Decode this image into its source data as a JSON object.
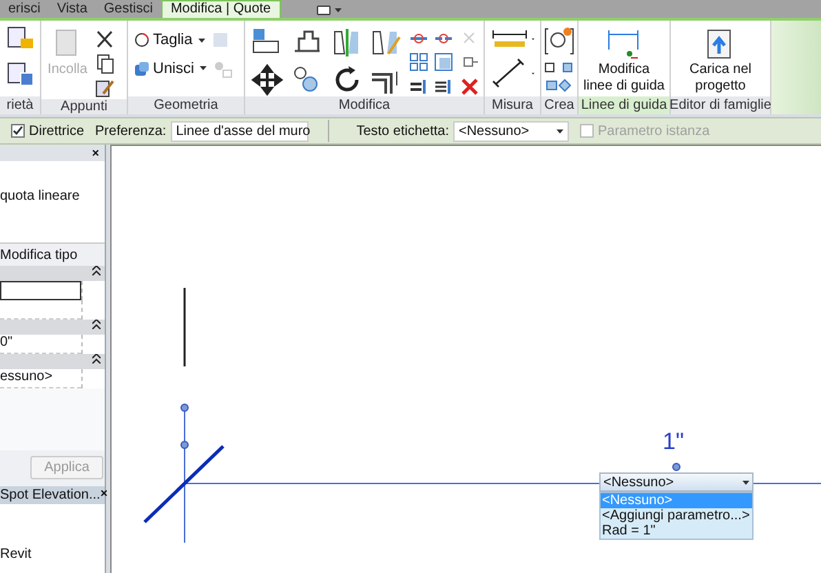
{
  "ribbon_tabs": [
    {
      "label": "erisci",
      "selected": false
    },
    {
      "label": "Vista",
      "selected": false
    },
    {
      "label": "Gestisci",
      "selected": false
    },
    {
      "label": "Modifica | Quote",
      "selected": true
    }
  ],
  "properties_panel_title": "rietà",
  "clipboard": {
    "title": "Appunti",
    "paste": {
      "label": "Incolla",
      "disabled": true
    }
  },
  "geometry": {
    "title": "Geometria",
    "cut": "Taglia",
    "join": "Unisci"
  },
  "modify": {
    "title": "Modifica"
  },
  "measure": {
    "title": "Misura"
  },
  "create": {
    "title": "Crea"
  },
  "guides": {
    "title": "Linee di guida",
    "button": "Modifica linee di guida"
  },
  "family_editor": {
    "title": "Editor di famiglie",
    "button": "Carica nel progetto"
  },
  "options_bar": {
    "leader": {
      "label": "Direttrice",
      "checked": true
    },
    "preference": {
      "label": "Preferenza:",
      "value": "Linee d'asse del muro"
    },
    "label_text": {
      "label": "Testo etichetta:",
      "value": "<Nessuno>"
    },
    "instance_parameter": {
      "label": "Parametro istanza",
      "checked": false,
      "disabled": true
    }
  },
  "properties": {
    "type_name": "quota lineare",
    "edit_type": "Modifica tipo",
    "close": "×",
    "groups": [
      {
        "fields": [
          {
            "kind": "input"
          },
          {
            "kind": "text"
          }
        ]
      },
      {
        "fields": [
          {
            "kind": "text",
            "value": "0\""
          }
        ]
      },
      {
        "fields": [
          {
            "kind": "text",
            "value": "essuno>"
          }
        ]
      }
    ],
    "apply": {
      "label": "Applica",
      "disabled": true
    }
  },
  "project_browser": {
    "title": "Spot Elevation...",
    "close": "×",
    "items": [
      "Revit"
    ]
  },
  "canvas": {
    "dimension_value": "1\"",
    "label_dropdown": {
      "value": "<Nessuno>",
      "options": [
        {
          "label": "<Nessuno>",
          "selected": true
        },
        {
          "label": "<Aggiungi parametro...>",
          "selected": false
        },
        {
          "label": "Rad = 1\"",
          "selected": false
        }
      ]
    }
  }
}
